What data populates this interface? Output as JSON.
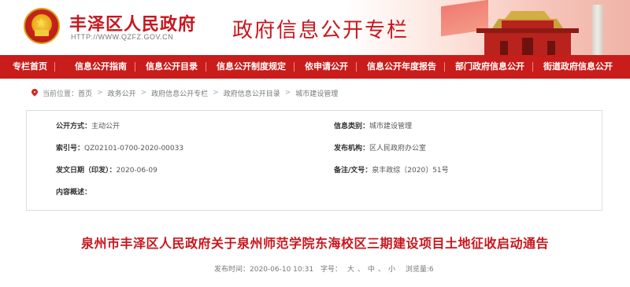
{
  "header": {
    "site_title": "丰泽区人民政府",
    "site_url": "HTTP://WWW.QZFZ.GOV.CN",
    "zone_title": "政府信息公开专栏"
  },
  "nav": {
    "items": [
      "专栏首页",
      "信息公开指南",
      "信息公开目录",
      "信息公开制度规定",
      "依申请公开",
      "信息公开年度报告",
      "部门政府信息公开",
      "街道政府信息公开"
    ]
  },
  "breadcrumb": {
    "prefix": "当前位置：",
    "items": [
      "首页",
      "政务公开",
      "政府信息公开专栏",
      "政府信息公开目录",
      "城市建设管理"
    ],
    "separator": ">"
  },
  "info": {
    "open_method_label": "公开方式：",
    "open_method_value": "主动公开",
    "category_label": "信息类别：",
    "category_value": "城市建设管理",
    "index_label": "索引号：",
    "index_value": "QZ02101-0700-2020-00033",
    "publisher_label": "发布机构：",
    "publisher_value": "区人民政府办公室",
    "issue_date_label": "发文日期（印发）：",
    "issue_date_value": "2020-06-09",
    "doc_no_label": "备注/文号：",
    "doc_no_value": "泉丰政综〔2020〕51号",
    "summary_label": "内容概述：",
    "summary_value": ""
  },
  "article": {
    "title": "泉州市丰泽区人民政府关于泉州师范学院东海校区三期建设项目土地征收启动通告",
    "publish_label": "发布时间：",
    "publish_time": "2020-06-10 10:31",
    "font_size_label": "字号：",
    "font_large": "大",
    "font_medium": "中",
    "font_small": "小",
    "views_label": "浏览量:",
    "views_value": "6"
  },
  "colors": {
    "brand_red": "#c81d1b",
    "title_red": "#c8161d"
  }
}
